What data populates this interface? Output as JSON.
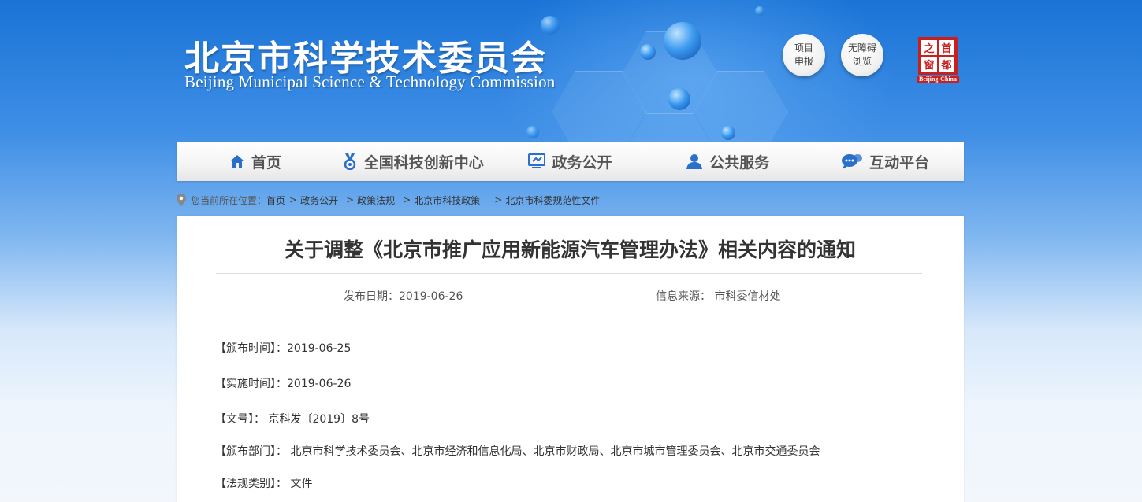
{
  "header": {
    "title_cn": "北京市科学技术委员会",
    "title_en": "Beijing Municipal Science & Technology Commission",
    "quick_buttons": [
      {
        "line1": "项目",
        "line2": "申报"
      },
      {
        "line1": "无障碍",
        "line2": "浏览"
      }
    ],
    "capital_badge": {
      "chars": [
        "首",
        "都",
        "之",
        "窗"
      ],
      "sub": "Beijing-China",
      "icon": "capital-window-seal"
    }
  },
  "nav": [
    {
      "label": "首页",
      "icon": "home-icon"
    },
    {
      "label": "全国科技创新中心",
      "icon": "medal-icon"
    },
    {
      "label": "政务公开",
      "icon": "monitor-icon"
    },
    {
      "label": "公共服务",
      "icon": "user-icon"
    },
    {
      "label": "互动平台",
      "icon": "chat-icon"
    }
  ],
  "breadcrumb": {
    "lead": "您当前所在位置：",
    "items": [
      "首页",
      "政务公开",
      "政策法规",
      "北京市科技政策",
      "北京市科委规范性文件"
    ]
  },
  "article": {
    "title": "关于调整《北京市推广应用新能源汽车管理办法》相关内容的通知",
    "publish_date": "发布日期：2019-06-26",
    "source": "信息来源： 市科委信材处",
    "fields": [
      "【颁布时间】：2019-06-25",
      "【实施时间】：2019-06-26",
      "【文号】： 京科发〔2019〕8号",
      "【颁布部门】： 北京市科学技术委员会、北京市经济和信息化局、北京市财政局、北京市城市管理委员会、北京市交通委员会",
      "【法规类别】： 文件"
    ]
  },
  "colors": {
    "header_blue": "#1a73d6",
    "nav_icon_blue": "#2a6fc9",
    "seal_red": "#c91f1f"
  }
}
